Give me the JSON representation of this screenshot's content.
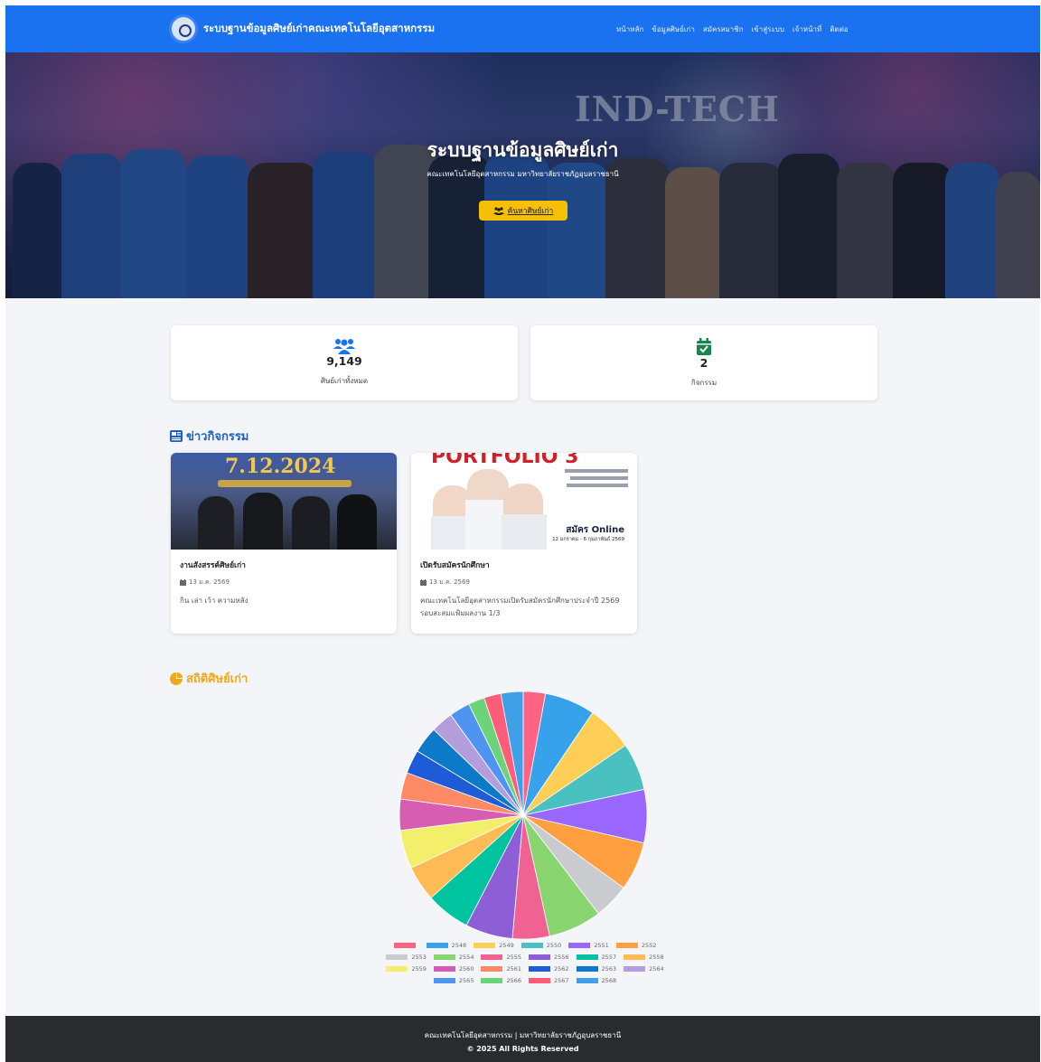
{
  "navbar": {
    "brand": "ระบบฐานข้อมูลศิษย์เก่าคณะเทคโนโลยีอุตสาหกรรม",
    "links": [
      "หน้าหลัก",
      "ข้อมูลศิษย์เก่า",
      "สมัครสมาชิก",
      "เข้าสู่ระบบ",
      "เจ้าหน้าที่",
      "ติดต่อ"
    ]
  },
  "hero": {
    "sign": "IND-TECH",
    "title": "ระบบฐานข้อมูลศิษย์เก่า",
    "subtitle": "คณะเทคโนโลยีอุตสาหกรรม มหาวิทยาลัยราชภัฏอุบลราชธานี",
    "button": "ค้นหาศิษย์เก่า"
  },
  "stats": [
    {
      "value": "9,149",
      "label": "ศิษย์เก่าทั้งหมด",
      "icon": "users-icon",
      "color": "#1a72f0"
    },
    {
      "value": "2",
      "label": "กิจกรรม",
      "icon": "calendar-check-icon",
      "color": "#17864a"
    }
  ],
  "news": {
    "title": "ข่าวกิจกรรม",
    "items": [
      {
        "image_text": "7.12.2024",
        "title": "งานสังสรรค์ศิษย์เก่า",
        "date": "13 ม.ค. 2569",
        "desc": "กิน เล่า เว้า ความหลัง"
      },
      {
        "image_text": "PORTFOLIO 3",
        "image_sub": "สมัคร Online",
        "image_date": "12 มกราคม - 6 กุมภาพันธ์ 2569",
        "title": "เปิดรับสมัครนักศึกษา",
        "date": "13 ม.ค. 2569",
        "desc": "คณะเทคโนโลยีอุตสาหกรรมเปิดรับสมัครนักศึกษาประจำปี 2569 รอบสะสมแฟ้มผลงาน 1/3"
      }
    ]
  },
  "statistics": {
    "title": "สถิติศิษย์เก่า"
  },
  "chart_data": {
    "type": "pie",
    "title": "",
    "categories": [
      "",
      "2548",
      "2549",
      "2550",
      "2551",
      "2552",
      "2553",
      "2554",
      "2555",
      "2556",
      "2557",
      "2558",
      "2559",
      "2560",
      "2561",
      "2562",
      "2563",
      "2564",
      "2565",
      "2566",
      "2567",
      "2568"
    ],
    "values": [
      300,
      680,
      620,
      640,
      720,
      660,
      480,
      720,
      500,
      640,
      600,
      480,
      520,
      420,
      360,
      320,
      360,
      300,
      280,
      220,
      230,
      300
    ],
    "colors": [
      "#ff6384",
      "#36a2eb",
      "#ffce56",
      "#4bc0c0",
      "#9966ff",
      "#ff9f40",
      "#c9cbcf",
      "#88d46e",
      "#f06292",
      "#8e5ed6",
      "#00c49f",
      "#ffbb55",
      "#f4ef6a",
      "#d65db1",
      "#ff8a65",
      "#1e5bd6",
      "#0c7ac9",
      "#b39ddb",
      "#4f94f0",
      "#6dd37a",
      "#ff5c7a",
      "#3fa0e8"
    ],
    "legend": "bottom"
  },
  "footer": {
    "line1": "คณะเทคโนโลยีอุตสาหกรรม | มหาวิทยาลัยราชภัฏอุบลราชธานี",
    "line2": "© 2025 All Rights Reserved"
  }
}
